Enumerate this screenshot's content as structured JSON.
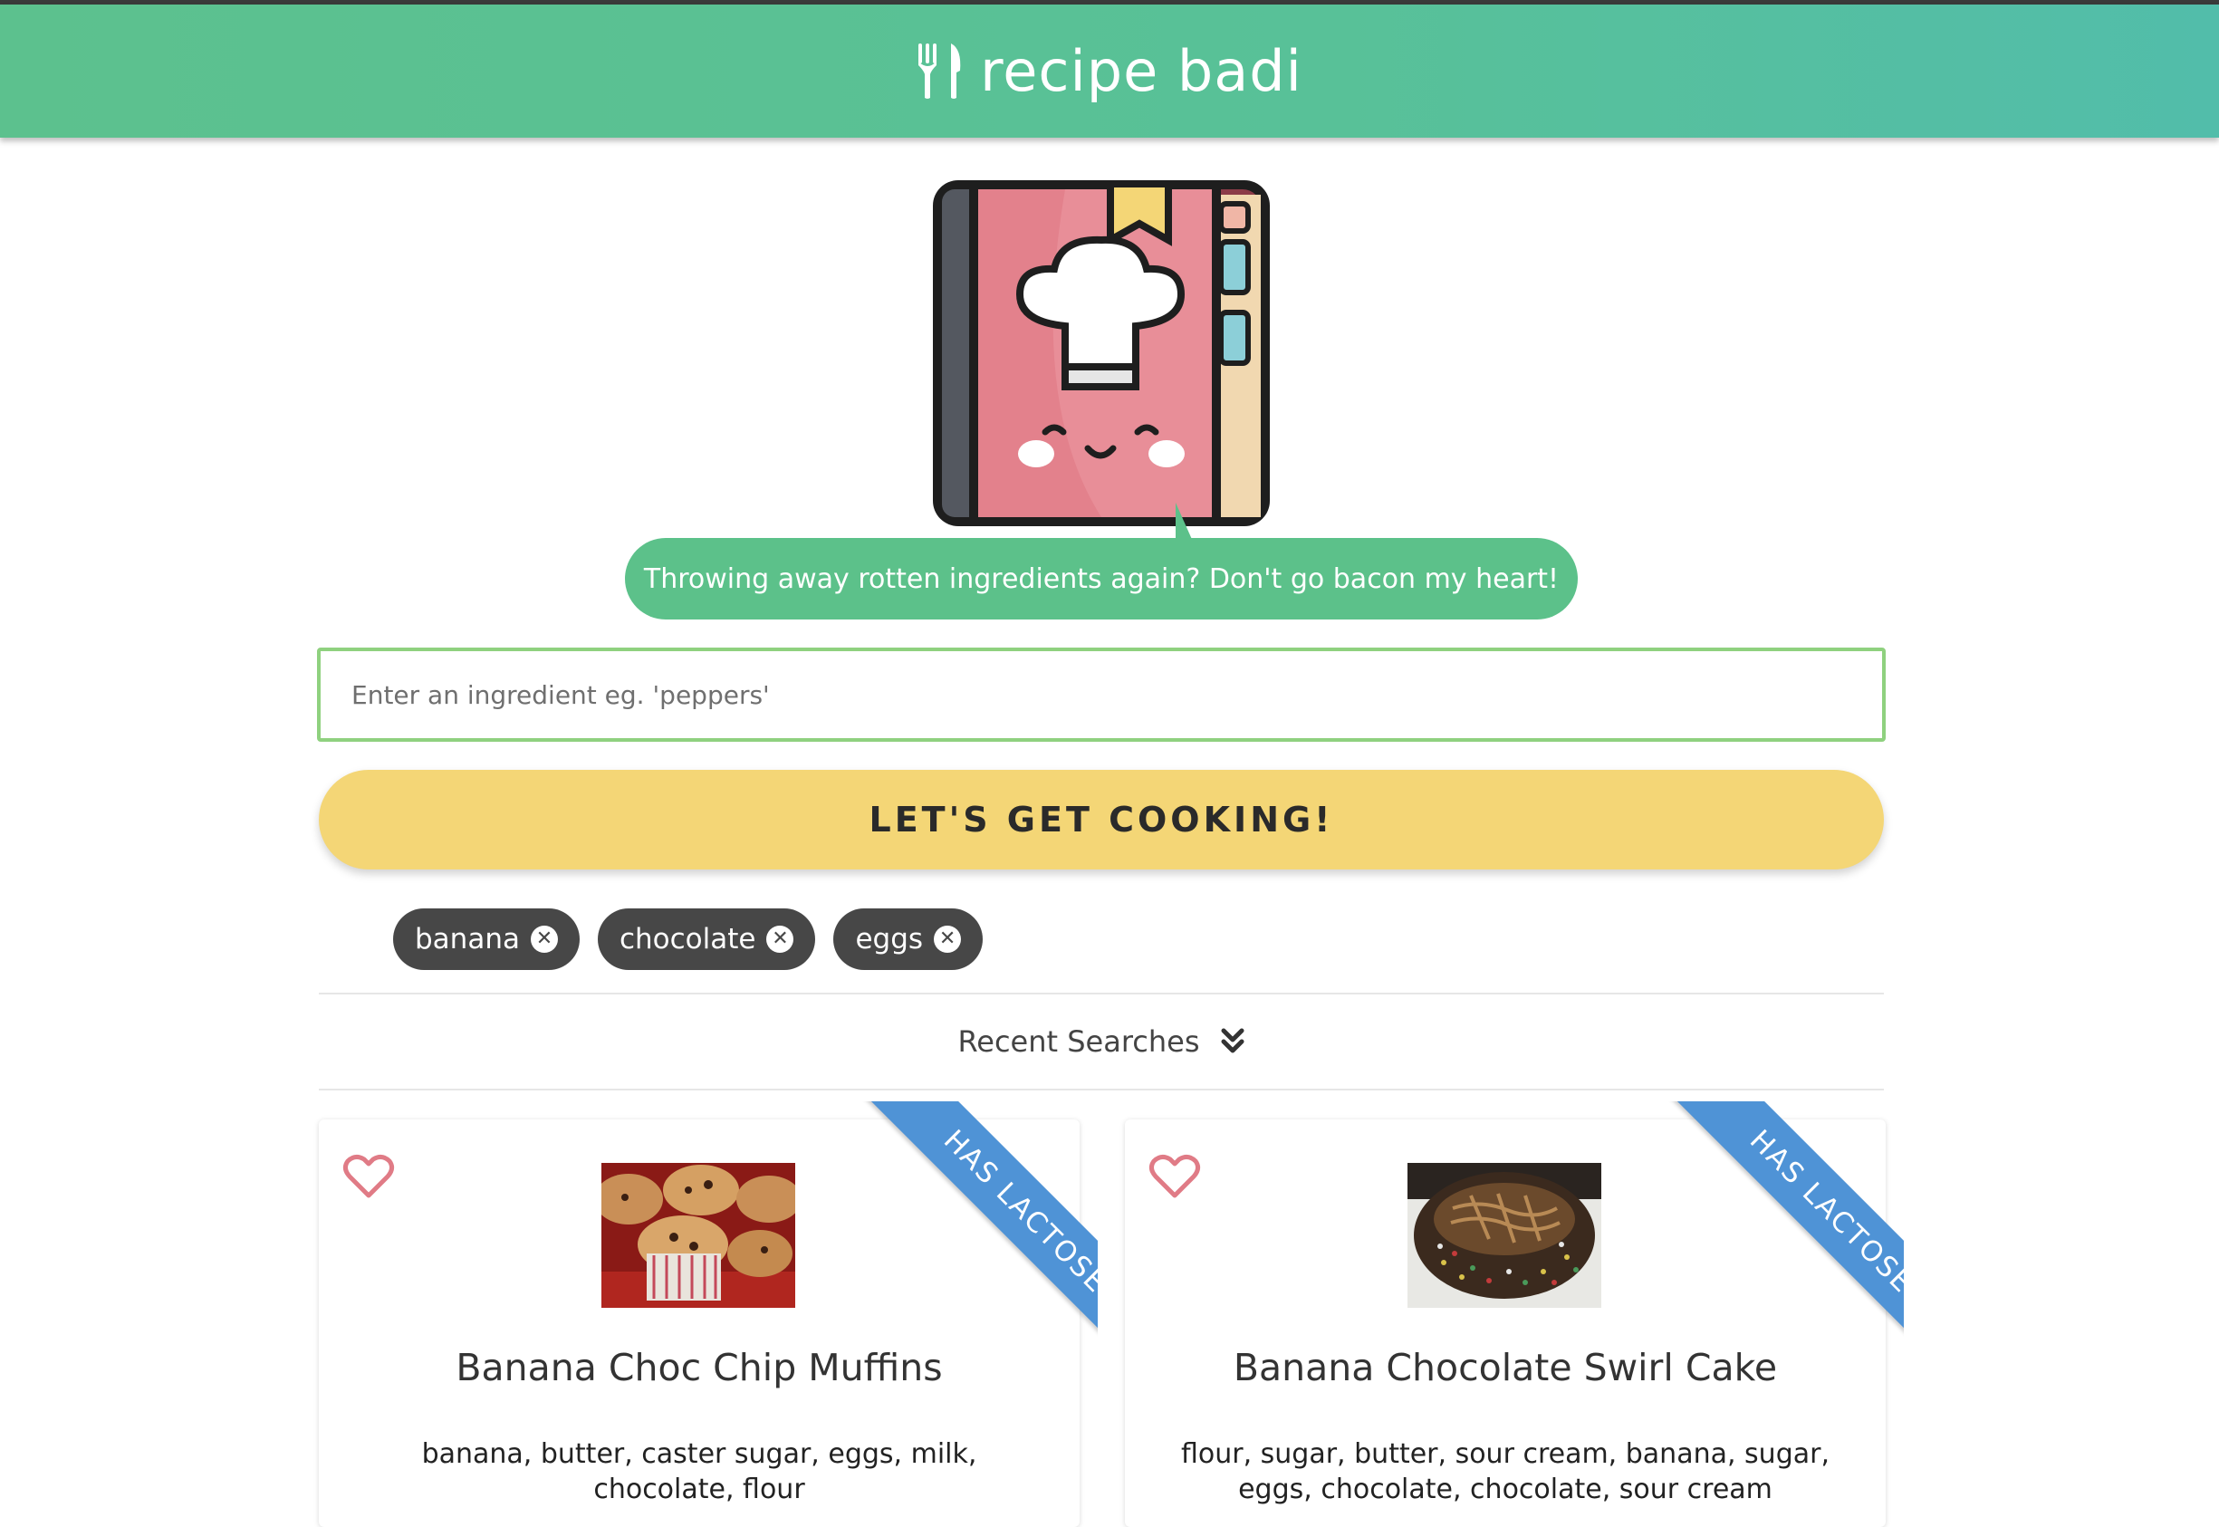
{
  "header": {
    "title": "recipe badi",
    "icon": "utensils-icon",
    "bg_color": "#5cc18e"
  },
  "mascot": {
    "icon": "cookbook-chef-icon"
  },
  "speech_bubble": {
    "text": "Throwing away rotten ingredients again? Don't go bacon my heart!"
  },
  "search": {
    "placeholder": "Enter an ingredient eg. 'peppers'",
    "value": ""
  },
  "cook_button": {
    "label": "LET'S GET COOKING!",
    "color": "#f4d676"
  },
  "ingredients": [
    {
      "label": "banana"
    },
    {
      "label": "chocolate"
    },
    {
      "label": "eggs"
    }
  ],
  "recent_searches": {
    "label": "Recent Searches",
    "icon": "double-chevron-down-icon"
  },
  "recipes": [
    {
      "title": "Banana Choc Chip Muffins",
      "ingredients": "banana, butter, caster sugar, eggs, milk, chocolate, flour",
      "badge": "HAS LACTOSE",
      "favorite": false
    },
    {
      "title": "Banana Chocolate Swirl Cake",
      "ingredients": "flour, sugar, butter, sour cream, banana, sugar, eggs, chocolate, chocolate, sour cream",
      "badge": "HAS LACTOSE",
      "favorite": false
    }
  ],
  "colors": {
    "accent_green": "#5cc18a",
    "chip_bg": "#474747",
    "badge_blue": "#4f93d6",
    "heart": "#e07b86"
  }
}
